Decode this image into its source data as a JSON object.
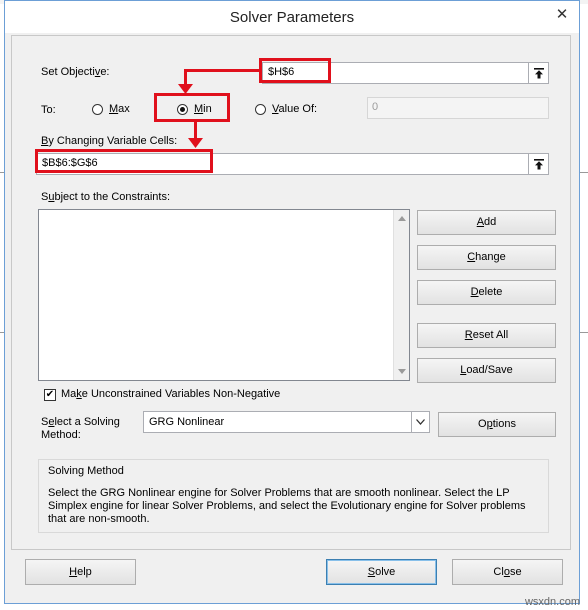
{
  "window": {
    "title": "Solver Parameters",
    "close_label": "✕"
  },
  "objective": {
    "label_pre": "Set Objecti",
    "label_u": "v",
    "label_post": "e:",
    "value": "$H$6"
  },
  "to": {
    "label": "To:",
    "max": {
      "u": "M",
      "rest": "ax"
    },
    "min": {
      "u": "M",
      "rest": "in"
    },
    "value_of": {
      "u": "V",
      "rest": "alue Of:"
    },
    "value": "0",
    "selected": "Min"
  },
  "variable_cells": {
    "label_u": "B",
    "label_rest": "y Changing Variable Cells:",
    "value": "$B$6:$G$6"
  },
  "constraints": {
    "label_pre": "S",
    "label_u": "u",
    "label_post": "bject to the Constraints:",
    "items": []
  },
  "buttons": {
    "add": {
      "u": "A",
      "rest": "dd"
    },
    "change": {
      "pre": "",
      "u": "C",
      "rest": "hange"
    },
    "delete": {
      "u": "D",
      "rest": "elete"
    },
    "reset_all": {
      "u": "R",
      "rest": "eset All"
    },
    "load_save": {
      "u": "L",
      "rest": "oad/Save"
    },
    "options": {
      "pre": "O",
      "u": "p",
      "rest": "tions"
    },
    "help": {
      "u": "H",
      "rest": "elp"
    },
    "solve": {
      "u": "S",
      "rest": "olve"
    },
    "close": {
      "pre": "Cl",
      "u": "o",
      "rest": "se"
    }
  },
  "nonneg": {
    "checked": true,
    "pre": "Ma",
    "u": "k",
    "rest": "e Unconstrained Variables Non-Negative"
  },
  "solving_method": {
    "label_line1_pre": "S",
    "label_line1_u": "e",
    "label_line1_post": "lect a Solving",
    "label_line2": "Method:",
    "selected": "GRG Nonlinear"
  },
  "method_info": {
    "title": "Solving Method",
    "text": "Select the GRG Nonlinear engine for Solver Problems that are smooth nonlinear. Select the LP Simplex engine for linear Solver Problems, and select the Evolutionary engine for Solver problems that are non-smooth."
  },
  "watermark": "wsxdn.com",
  "colors": {
    "annotation": "#e0101c",
    "window_bg": "#f0f0f0"
  },
  "icons": {
    "ref_button": "collapse-dialog-icon",
    "dropdown": "chevron-down-icon"
  }
}
